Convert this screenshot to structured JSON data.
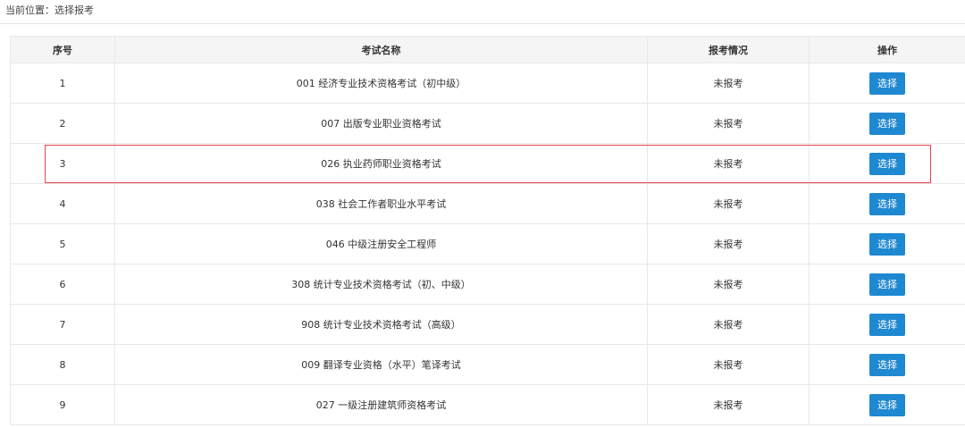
{
  "breadcrumb": {
    "text": "当前位置：选择报考"
  },
  "table": {
    "headers": [
      "序号",
      "考试名称",
      "报考情况",
      "操作"
    ],
    "rows": [
      {
        "index": "1",
        "name": "001 经济专业技术资格考试（初中级）",
        "status": "未报考",
        "action": "选择"
      },
      {
        "index": "2",
        "name": "007 出版专业职业资格考试",
        "status": "未报考",
        "action": "选择"
      },
      {
        "index": "3",
        "name": "026 执业药师职业资格考试",
        "status": "未报考",
        "action": "选择"
      },
      {
        "index": "4",
        "name": "038 社会工作者职业水平考试",
        "status": "未报考",
        "action": "选择"
      },
      {
        "index": "5",
        "name": "046 中级注册安全工程师",
        "status": "未报考",
        "action": "选择"
      },
      {
        "index": "6",
        "name": "308 统计专业技术资格考试（初、中级）",
        "status": "未报考",
        "action": "选择"
      },
      {
        "index": "7",
        "name": "908 统计专业技术资格考试（高级）",
        "status": "未报考",
        "action": "选择"
      },
      {
        "index": "8",
        "name": "009 翻译专业资格（水平）笔译考试",
        "status": "未报考",
        "action": "选择"
      },
      {
        "index": "9",
        "name": "027 一级注册建筑师资格考试",
        "status": "未报考",
        "action": "选择"
      }
    ]
  },
  "colors": {
    "button": "#1e88d0",
    "highlight": "#e8454a",
    "header_bg": "#f5f5f5"
  }
}
